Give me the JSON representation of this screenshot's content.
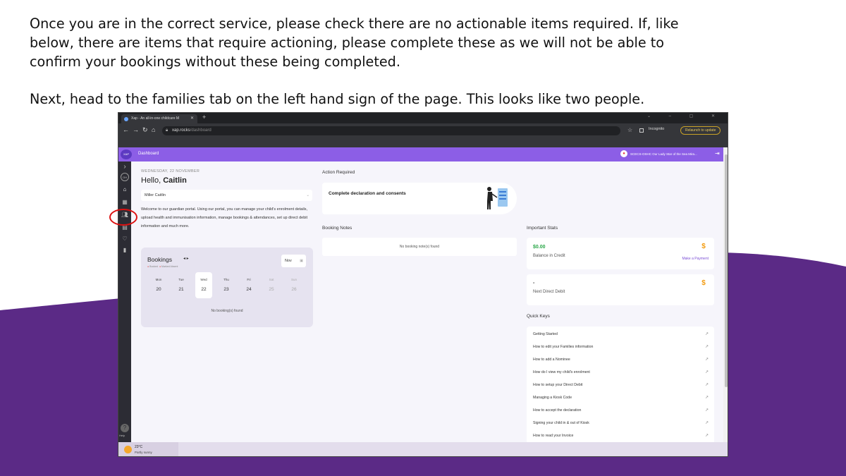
{
  "instructions": {
    "line1": "Once you are in the correct service, please check there are no actionable items required. If, like",
    "line2": "below, there are items that require actioning, please complete these as we will not be able to",
    "line3": "confirm your bookings without these being completed.",
    "line4": "Next, head to the families tab on the left hand sign of the page. This looks like two people."
  },
  "browser": {
    "tab_title": "Xap - An all-in-one childcare M",
    "new_tab": "+",
    "url_host": "xap.rocks",
    "url_path": "/dashboard",
    "incognito_label": "Incognito",
    "relaunch_label": "Relaunch to update"
  },
  "app": {
    "logo_text": "XAP",
    "page_title": "Dashboard",
    "service_name": "SCECS-OSHC Our Lady Star of the Sea Mira..."
  },
  "sidebar": {
    "help_label": "Help"
  },
  "main": {
    "date": "WEDNESDAY, 22 NOVEMBER",
    "greeting": "Hello,",
    "greeting_name": "Caitlin",
    "child_select": "Miller Caitlin",
    "welcome_text": "Welcome to our guardian portal. Using our portal, you can manage your child's enrolment details, upload health and immunisation information, manage bookings & attendances, set up direct debit information and much more."
  },
  "bookings": {
    "title": "Bookings",
    "legend_booked": "Booked",
    "legend_marked_absent": "Marked Absent",
    "month": "Nov",
    "days": [
      {
        "name": "Mon",
        "num": "20"
      },
      {
        "name": "Tue",
        "num": "21"
      },
      {
        "name": "Wed",
        "num": "22"
      },
      {
        "name": "Thu",
        "num": "23"
      },
      {
        "name": "Fri",
        "num": "24"
      },
      {
        "name": "Sat",
        "num": "25"
      },
      {
        "name": "Sun",
        "num": "26"
      }
    ],
    "empty_text": "No booking(s) found"
  },
  "action_required": {
    "heading": "Action Required",
    "item": "Complete declaration and consents"
  },
  "booking_notes": {
    "heading": "Booking Notes",
    "empty_text": "No booking note(s) found"
  },
  "important_stats": {
    "heading": "Important Stats",
    "balance_value": "$0.00",
    "balance_label": "Balance in Credit",
    "make_payment": "Make a Payment",
    "debit_value": "-",
    "debit_label": "Next Direct Debit",
    "dollar_glyph": "$"
  },
  "quick_keys": {
    "heading": "Quick Keys",
    "items": [
      "Getting Started",
      "How to edit your Families information",
      "How to add a Nominee",
      "How do I view my child's enrolment",
      "How to setup your Direct Debit",
      "Managing a Kiosk Code",
      "How to accept the declaration",
      "Signing your child in & out of Kiosk",
      "How to read your Invoice"
    ]
  },
  "taskbar": {
    "temperature": "23°C",
    "condition": "Partly sunny"
  },
  "colors": {
    "app_header": "#8c5ee6",
    "slide_purple": "#5b2a86",
    "balance_green": "#2aa748",
    "dollar_orange": "#f39c12",
    "highlight_ring": "#dd1111"
  }
}
